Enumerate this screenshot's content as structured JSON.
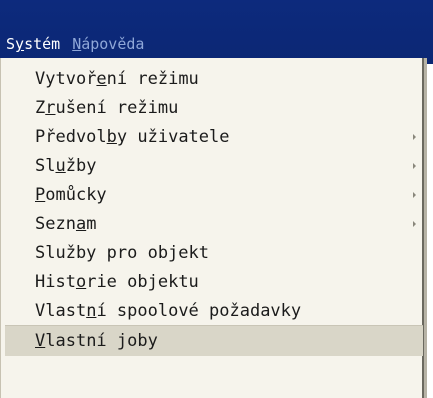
{
  "menubar": {
    "items": [
      {
        "pre": "S",
        "u": "y",
        "post": "stém",
        "state": "active"
      },
      {
        "pre": "",
        "u": "N",
        "post": "ápověda",
        "state": "inactive"
      }
    ]
  },
  "menu": {
    "items": [
      {
        "pre": "Vytvoř",
        "u": "e",
        "post": "ní režimu",
        "submenu": false
      },
      {
        "pre": "Z",
        "u": "r",
        "post": "ušení režimu",
        "submenu": false
      },
      {
        "pre": "Předvol",
        "u": "b",
        "post": "y uživatele",
        "submenu": true
      },
      {
        "pre": "Sl",
        "u": "u",
        "post": "žby",
        "submenu": true
      },
      {
        "pre": "",
        "u": "P",
        "post": "omůcky",
        "submenu": true
      },
      {
        "pre": "Sezn",
        "u": "a",
        "post": "m",
        "submenu": true
      },
      {
        "pre": "Služby pro objekt",
        "u": "",
        "post": "",
        "submenu": false
      },
      {
        "pre": "Hist",
        "u": "o",
        "post": "rie objektu",
        "submenu": false
      },
      {
        "pre": "Vlast",
        "u": "n",
        "post": "í spoolové požadavky",
        "submenu": false
      },
      {
        "pre": "",
        "u": "V",
        "post": "lastní joby",
        "submenu": false,
        "highlighted": true
      }
    ]
  }
}
